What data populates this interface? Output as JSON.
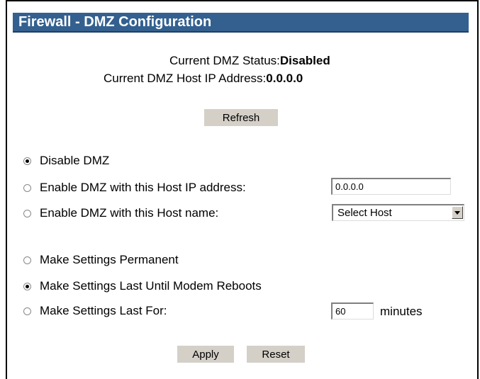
{
  "header": {
    "title": "Firewall - DMZ Configuration"
  },
  "status": {
    "dmz_status_label": "Current DMZ Status:",
    "dmz_status_value": "Disabled",
    "host_ip_label": "Current DMZ Host IP Address:",
    "host_ip_value": "0.0.0.0"
  },
  "buttons": {
    "refresh": "Refresh",
    "apply": "Apply",
    "reset": "Reset"
  },
  "dmz_options": {
    "disable_label": "Disable DMZ",
    "enable_ip_label": "Enable DMZ with this Host IP address:",
    "enable_name_label": "Enable DMZ with this Host name:",
    "selected": "disable",
    "host_ip_input": "0.0.0.0",
    "host_select": "Select Host"
  },
  "duration_options": {
    "permanent_label": "Make Settings Permanent",
    "until_reboot_label": "Make Settings Last Until Modem Reboots",
    "last_for_label": "Make Settings Last For:",
    "selected": "until_reboot",
    "minutes_value": "60",
    "minutes_unit": "minutes"
  },
  "colors": {
    "title_bar": "#33608f",
    "button_face": "#d4d0c8"
  }
}
